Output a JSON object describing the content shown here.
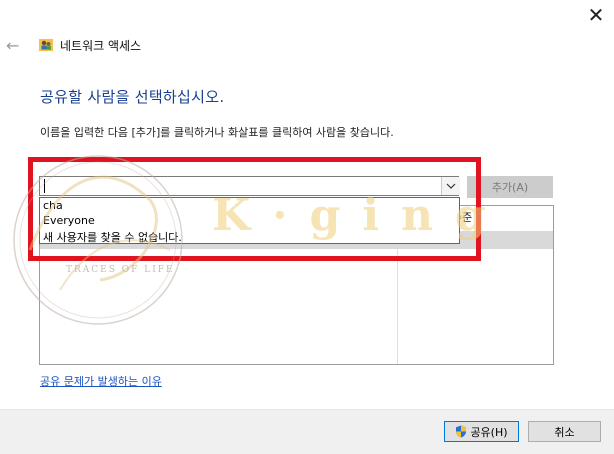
{
  "window": {
    "title": "네트워크 액세스",
    "close_glyph": "✕",
    "back_glyph": "←"
  },
  "heading": "공유할 사람을 선택하십시오.",
  "instruction": "이름을 입력한 다음 [추가]를 클릭하거나 화살표를 클릭하여 사람을 찾습니다.",
  "combo": {
    "value": "",
    "add_label": "추가(A)"
  },
  "autocomplete": {
    "items": [
      "cha",
      "Everyone",
      "새 사용자를 찾을 수 없습니다."
    ]
  },
  "list": {
    "column_level_partial": "수준"
  },
  "watermark": {
    "brand": "K·ging",
    "tagline": "TRACES OF LIFE"
  },
  "help_link": "공유 문제가 발생하는 이유",
  "footer": {
    "share_label": "공유(H)",
    "cancel_label": "취소"
  },
  "colors": {
    "heading": "#1a3f8f",
    "highlight": "#e0141e",
    "link": "#1c54c0",
    "footer_bg": "#f0f0f0"
  }
}
